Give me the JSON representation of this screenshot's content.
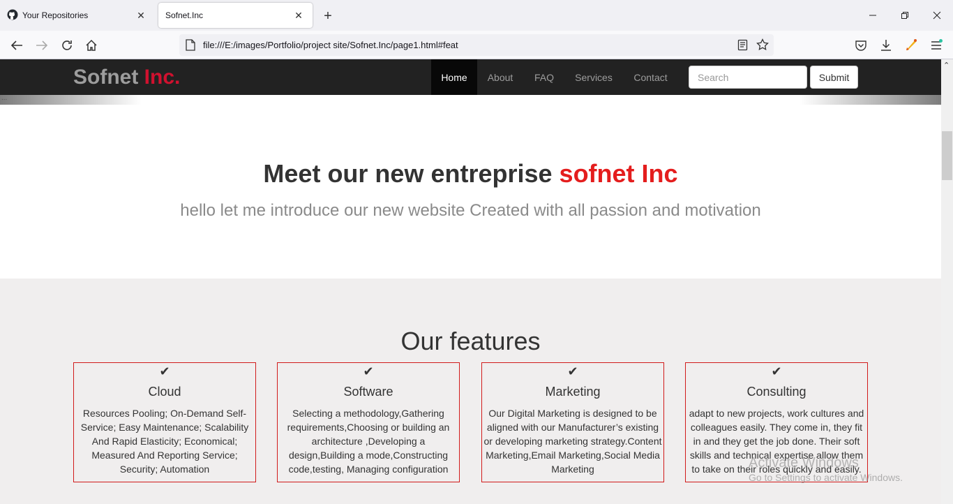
{
  "browser": {
    "tabs": [
      {
        "title": "Your Repositories",
        "icon": "github-icon",
        "active": false
      },
      {
        "title": "Sofnet.Inc",
        "active": true
      }
    ],
    "url": "file:///E:/images/Portfolio/project site/Sofnet.Inc/page1.html#feat"
  },
  "site": {
    "brand": {
      "main": "Sofnet",
      "accent": "Inc."
    },
    "nav": [
      {
        "label": "Home",
        "active": true
      },
      {
        "label": "About"
      },
      {
        "label": "FAQ"
      },
      {
        "label": "Services"
      },
      {
        "label": "Contact"
      }
    ],
    "search": {
      "placeholder": "Search",
      "value": ""
    },
    "submit_label": "Submit",
    "carousel_dots": "..."
  },
  "hero": {
    "title_main": "Meet our new entreprise",
    "title_accent": "sofnet Inc",
    "subtitle": "hello let me introduce our new website Created with all passion and motivation"
  },
  "features": {
    "title": "Our features",
    "check_glyph": "✔",
    "items": [
      {
        "title": "Cloud",
        "body": "Resources Pooling; On-Demand Self-Service; Easy Maintenance; Scalability And Rapid Elasticity; Economical; Measured And Reporting Service; Security; Automation"
      },
      {
        "title": "Software",
        "body": "Selecting a methodology,Gathering requirements,Choosing or building an architecture ,Developing a design,Building a mode,Constructing code,testing, Managing configuration"
      },
      {
        "title": "Marketing",
        "body": "Our Digital Marketing is designed to be aligned with our Manufacturer’s existing or developing marketing strategy.Content Marketing,Email Marketing,Social Media Marketing"
      },
      {
        "title": "Consulting",
        "body": "adapt to new projects, work cultures and colleagues easily. They come in, they fit in and they get the job done. Their soft skills and technical expertise allow them to take on their roles quickly and easily."
      }
    ]
  },
  "watermark": {
    "line1": "Activate Windows",
    "line2": "Go to Settings to activate Windows."
  },
  "colors": {
    "nav_bg": "#222222",
    "brand_accent": "#d0112f",
    "hero_accent": "#e41d1d",
    "card_border": "#d11a1a"
  }
}
